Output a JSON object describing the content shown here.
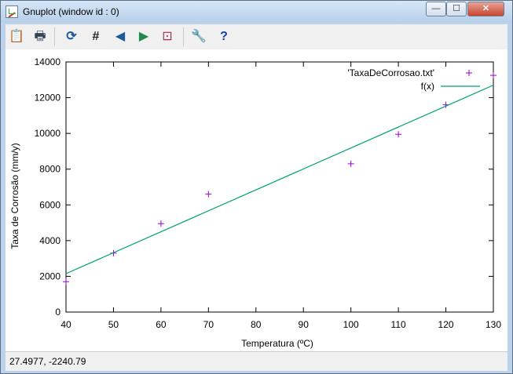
{
  "window": {
    "title": "Gnuplot (window id : 0)"
  },
  "controls": {
    "minimize": "—",
    "maximize": "☐",
    "close": "✕"
  },
  "toolbar": {
    "items": [
      {
        "name": "clipboard-icon",
        "glyph": "📋"
      },
      {
        "name": "print-icon",
        "glyph": "🖶"
      },
      {
        "name": "replot-icon",
        "glyph": "⟳"
      },
      {
        "name": "grid-icon",
        "glyph": "#"
      },
      {
        "name": "zoom-prev-icon",
        "glyph": "◀"
      },
      {
        "name": "zoom-next-icon",
        "glyph": "▶"
      },
      {
        "name": "autoscale-icon",
        "glyph": "⊡"
      },
      {
        "name": "options-icon",
        "glyph": "🔧"
      },
      {
        "name": "help-icon",
        "glyph": "?"
      }
    ]
  },
  "status": {
    "text": "27.4977, -2240.79"
  },
  "chart_data": {
    "type": "scatter",
    "xlabel": "Temperatura (ºC)",
    "ylabel": "Taxa de Corrosão (mm/y)",
    "xlim": [
      40,
      130
    ],
    "ylim": [
      0,
      14000
    ],
    "xticks": [
      "40",
      "50",
      "60",
      "70",
      "80",
      "90",
      "100",
      "110",
      "120",
      "130"
    ],
    "yticks": [
      "0",
      "2000",
      "4000",
      "6000",
      "8000",
      "10000",
      "12000",
      "14000"
    ],
    "legend_position": "top-right",
    "series": [
      {
        "name": "'TaxaDeCorrosao.txt'",
        "kind": "points",
        "color": "#9400d3",
        "x": [
          40,
          50,
          60,
          70,
          100,
          110,
          120,
          130
        ],
        "y": [
          1700,
          3300,
          4950,
          6600,
          8300,
          9950,
          11600,
          13250
        ]
      },
      {
        "name": "f(x)",
        "kind": "line",
        "color": "#009e73",
        "x": [
          40,
          130
        ],
        "y": [
          2150,
          12700
        ]
      }
    ]
  }
}
